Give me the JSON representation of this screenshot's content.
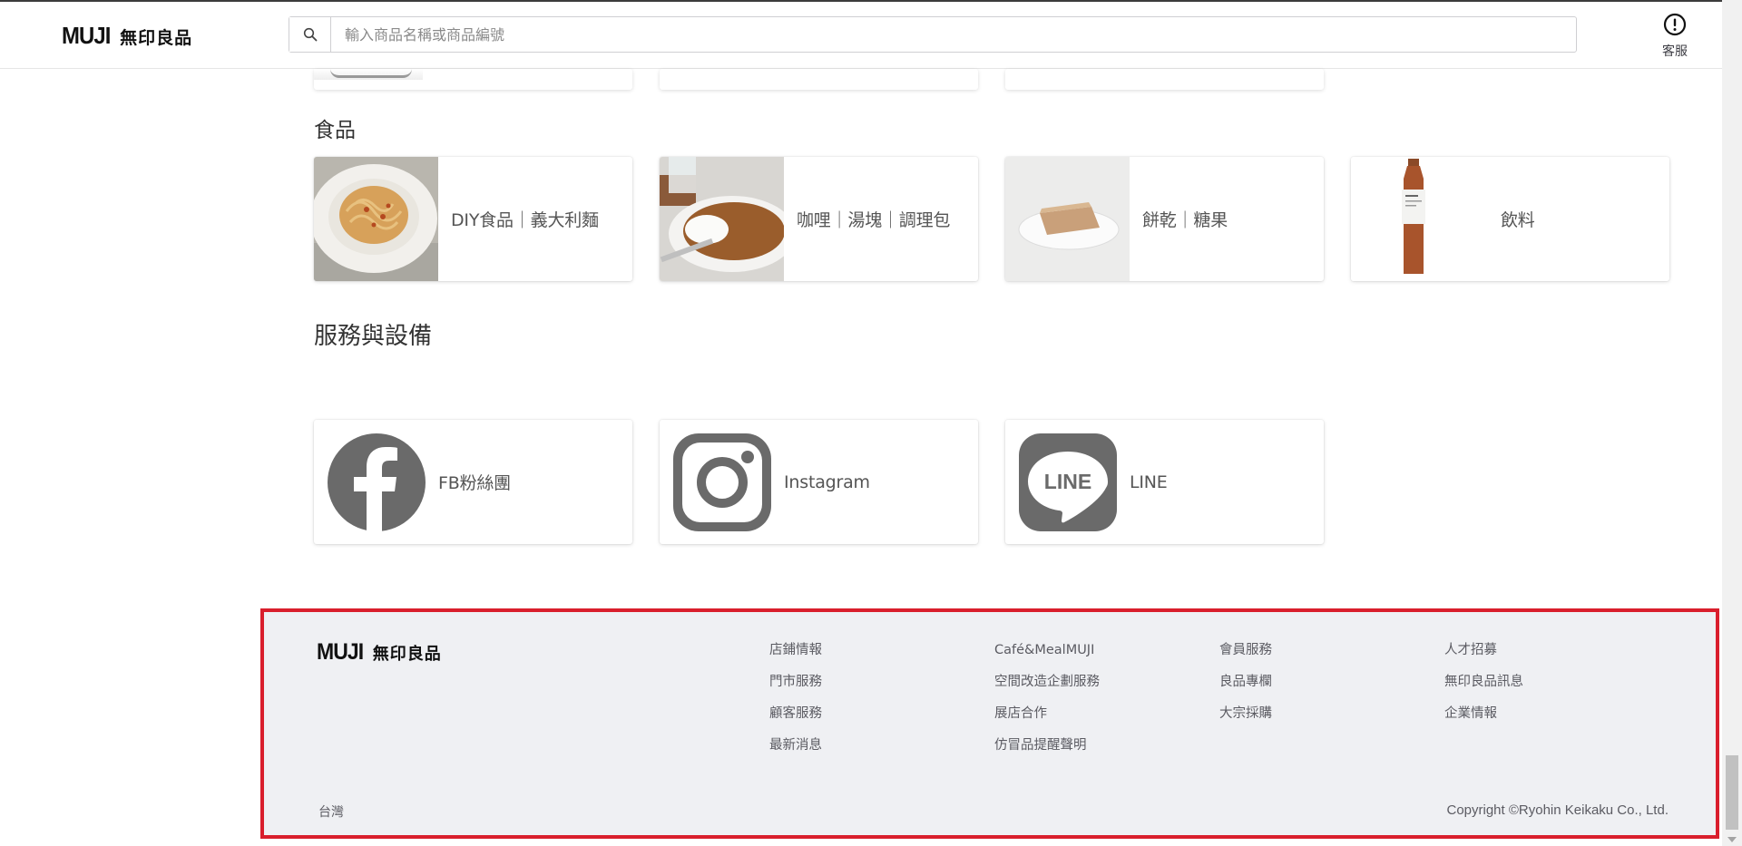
{
  "header": {
    "logo_en": "MUJI",
    "logo_jp": "無印良品",
    "search_placeholder": "輸入商品名稱或商品編號",
    "customer_service_label": "客服"
  },
  "food": {
    "title": "食品",
    "cards": [
      {
        "label": "DIY食品｜義大利麵",
        "image": "pasta-image"
      },
      {
        "label": "咖哩｜湯塊｜調理包",
        "image": "curry-image"
      },
      {
        "label": "餅乾｜糖果",
        "image": "cake-image"
      },
      {
        "label": "飲料",
        "image": "tea-bottle-image"
      }
    ]
  },
  "services": {
    "title": "服務與設備",
    "cards": [
      {
        "label": "FB粉絲團",
        "icon": "facebook-icon"
      },
      {
        "label": "Instagram",
        "icon": "instagram-icon"
      },
      {
        "label": "LINE",
        "icon": "line-icon"
      }
    ]
  },
  "footer": {
    "logo_en": "MUJI",
    "logo_jp": "無印良品",
    "columns": [
      [
        "店鋪情報",
        "門市服務",
        "顧客服務",
        "最新消息"
      ],
      [
        "Café&MealMUJI",
        "空間改造企劃服務",
        "展店合作",
        "仿冒品提醒聲明"
      ],
      [
        "會員服務",
        "良品專欄",
        "大宗採購"
      ],
      [
        "人才招募",
        "無印良品訊息",
        "企業情報"
      ]
    ],
    "region": "台灣",
    "copyright": "Copyright ©Ryohin Keikaku Co., Ltd."
  },
  "colors": {
    "highlight_border": "#d91e2c",
    "footer_bg": "#eff0f3",
    "icon_gray": "#6a6a6a"
  }
}
